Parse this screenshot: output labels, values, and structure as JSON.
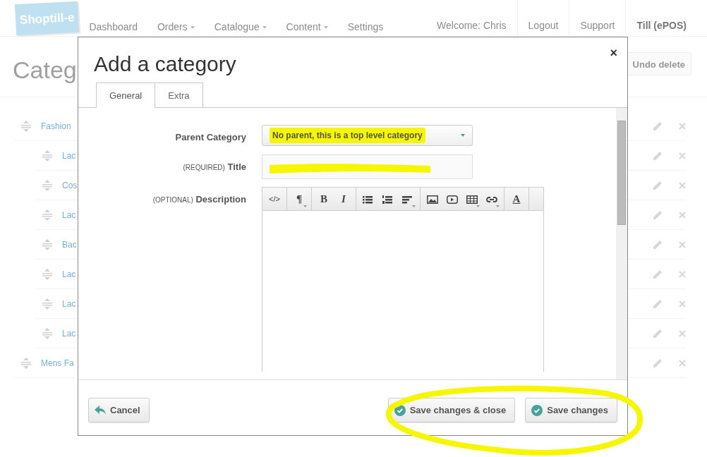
{
  "logo": {
    "text": "Shoptill-e"
  },
  "nav": [
    {
      "label": "Dashboard",
      "dropdown": false
    },
    {
      "label": "Orders",
      "dropdown": true
    },
    {
      "label": "Catalogue",
      "dropdown": true
    },
    {
      "label": "Content",
      "dropdown": true
    },
    {
      "label": "Settings",
      "dropdown": false
    }
  ],
  "user_nav": [
    {
      "label": "Welcome: Chris",
      "kind": "text"
    },
    {
      "label": "Logout",
      "kind": "link"
    },
    {
      "label": "Support",
      "kind": "link"
    },
    {
      "label": "Till (ePOS)",
      "kind": "strong"
    }
  ],
  "page": {
    "title": "Categ",
    "undo_button": "Undo delete"
  },
  "categories": [
    {
      "name": "Fashion",
      "children": [
        {
          "name": "Lac"
        },
        {
          "name": "Cos"
        },
        {
          "name": "Lac"
        },
        {
          "name": "Bac"
        },
        {
          "name": "Lac"
        },
        {
          "name": "Lac"
        },
        {
          "name": "Lac"
        }
      ]
    },
    {
      "name": "Mens Fa"
    }
  ],
  "modal": {
    "title": "Add a category",
    "close": "×",
    "tabs": [
      {
        "label": "General",
        "selected": true
      },
      {
        "label": "Extra",
        "selected": false
      }
    ],
    "fields": [
      {
        "kind": "select",
        "label": "Parent Category",
        "value": "No parent, this is a top level category"
      },
      {
        "kind": "input",
        "note": "(REQUIRED)",
        "label": "Title"
      },
      {
        "kind": "editor",
        "note": "(OPTIONAL)",
        "label": "Description"
      }
    ],
    "toolbar": [
      [
        {
          "kind": "code",
          "label": "</>"
        }
      ],
      [
        {
          "kind": "paragraph",
          "label": "¶",
          "dropdown": true
        }
      ],
      [
        {
          "kind": "bold",
          "label": "B"
        },
        {
          "kind": "italic",
          "label": "I"
        }
      ],
      [
        {
          "kind": "bullets"
        },
        {
          "kind": "numbers"
        },
        {
          "kind": "align",
          "dropdown": true
        }
      ],
      [
        {
          "kind": "image"
        },
        {
          "kind": "video"
        },
        {
          "kind": "table",
          "dropdown": true
        },
        {
          "kind": "link",
          "dropdown": true
        }
      ],
      [
        {
          "kind": "color",
          "label": "A"
        }
      ]
    ],
    "buttons": [
      {
        "kind": "cancel",
        "label": "Cancel"
      },
      {
        "kind": "save",
        "label": "Save changes & close"
      },
      {
        "kind": "save",
        "label": "Save changes"
      }
    ]
  }
}
